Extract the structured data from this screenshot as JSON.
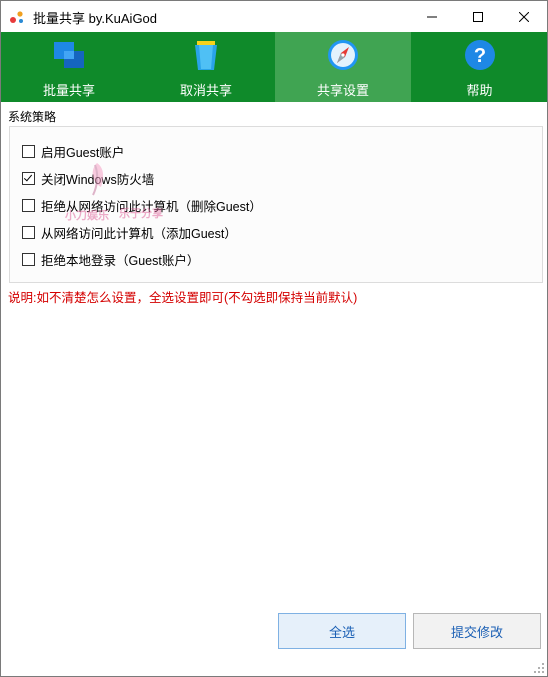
{
  "window": {
    "title": "批量共享 by.KuAiGod"
  },
  "tabs": [
    {
      "label": "批量共享",
      "icon": "windows-logo-icon",
      "active": false
    },
    {
      "label": "取消共享",
      "icon": "recycle-bin-icon",
      "active": false
    },
    {
      "label": "共享设置",
      "icon": "compass-icon",
      "active": true
    },
    {
      "label": "帮助",
      "icon": "help-icon",
      "active": false
    }
  ],
  "group": {
    "title": "系统策略",
    "options": [
      {
        "label": "启用Guest账户",
        "checked": false
      },
      {
        "label": "关闭Windows防火墙",
        "checked": true
      },
      {
        "label": "拒绝从网络访问此计算机（删除Guest）",
        "checked": false
      },
      {
        "label": "从网络访问此计算机（添加Guest）",
        "checked": false
      },
      {
        "label": "拒绝本地登录（Guest账户）",
        "checked": false
      }
    ]
  },
  "watermark": {
    "line1": "小刀娱乐",
    "line2": "乐于分享"
  },
  "note": "说明:如不清楚怎么设置，全选设置即可(不勾选即保持当前默认)",
  "buttons": {
    "select_all": "全选",
    "submit": "提交修改"
  },
  "colors": {
    "tabbar": "#0f8a2a",
    "tab_active": "#40a452",
    "note_text": "#d40000"
  }
}
